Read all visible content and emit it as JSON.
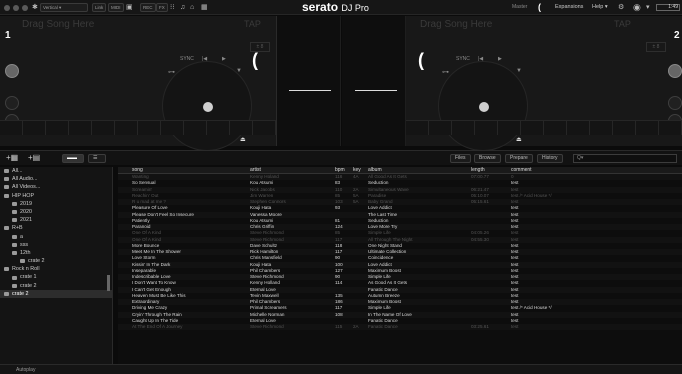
{
  "window": {
    "layout": "Vertical",
    "master": "Master",
    "expansions": "Expansions",
    "help": "Help ▾",
    "clock": "1:49"
  },
  "toolbar": {
    "link": "Link",
    "midi": "MIDI",
    "rec": "REC",
    "fx": "FX"
  },
  "logo": {
    "brand": "serato",
    "product": "DJ Pro"
  },
  "deckA": {
    "number": "1",
    "title": "Drag Song Here",
    "tap": "TAP",
    "sync": "SYNC"
  },
  "deckB": {
    "number": "2",
    "title": "Drag Song Here",
    "tap": "TAP",
    "sync": "SYNC"
  },
  "library_tabs": {
    "files": "Files",
    "browse": "Browse",
    "prepare": "Prepare",
    "history": "History",
    "search_placeholder": "Q▾"
  },
  "sidebar": {
    "items": [
      {
        "label": "All..."
      },
      {
        "label": "All Audio..."
      },
      {
        "label": "All Videos..."
      },
      {
        "label": "HIP HOP"
      },
      {
        "label": "2019"
      },
      {
        "label": "2020"
      },
      {
        "label": "2021"
      },
      {
        "label": "R+B"
      },
      {
        "label": "a"
      },
      {
        "label": "sss"
      },
      {
        "label": "12th"
      },
      {
        "label": "crate 2"
      },
      {
        "label": "Rock n Roll"
      },
      {
        "label": "crate 1"
      },
      {
        "label": "crate 2"
      },
      {
        "label": "crate 2"
      }
    ]
  },
  "columns": {
    "song": "song",
    "artist": "artist",
    "bpm": "bpm",
    "key": "key",
    "album": "album",
    "length": "length",
    "comment": "comment"
  },
  "tracks": [
    {
      "song": "Wanting",
      "artist": "Kenny Holand",
      "bpm": "116",
      "key": "4A",
      "album": "All Good As It Gets",
      "length": "07:00.77",
      "comment": "0",
      "dim": true
    },
    {
      "song": "So Sensual",
      "artist": "Kou Atsumi",
      "bpm": "83",
      "key": "",
      "album": "Seduction",
      "length": "",
      "comment": "test",
      "dim": false
    },
    {
      "song": "Screamin'",
      "artist": "Nick Jacobs",
      "bpm": "110",
      "key": "2A",
      "album": "Simultaneous Wave",
      "length": "06:21.47",
      "comment": "test",
      "dim": true
    },
    {
      "song": "Reachin' Out",
      "artist": "Jim Warren",
      "bpm": "85",
      "key": "5A",
      "album": "Paradise",
      "length": "05:10.07",
      "comment": "test /* Acid House */",
      "dim": true
    },
    {
      "song": "R u mad at me ?",
      "artist": "Stephen Connors",
      "bpm": "103",
      "key": "5A",
      "album": "Baby Grand",
      "length": "05:15.61",
      "comment": "test",
      "dim": true
    },
    {
      "song": "Pleasure Of Love",
      "artist": "Kouji Hata",
      "bpm": "93",
      "key": "",
      "album": "Love Addict",
      "length": "",
      "comment": "test",
      "dim": false
    },
    {
      "song": "Please Don't Feel So Insecure",
      "artist": "Vanessa Moore",
      "bpm": "",
      "key": "",
      "album": "The Last Time",
      "length": "",
      "comment": "test",
      "dim": false
    },
    {
      "song": "Patiently",
      "artist": "Kou Atsumi",
      "bpm": "81",
      "key": "",
      "album": "Seduction",
      "length": "",
      "comment": "test",
      "dim": false
    },
    {
      "song": "Paranoid",
      "artist": "Chris Griffin",
      "bpm": "124",
      "key": "",
      "album": "Love More Try",
      "length": "",
      "comment": "test",
      "dim": false
    },
    {
      "song": "One Of A Kind",
      "artist": "Steve Richmond",
      "bpm": "85",
      "key": "",
      "album": "Simple Life",
      "length": "04:05.26",
      "comment": "test",
      "dim": true
    },
    {
      "song": "One Of A Kind",
      "artist": "Steve Richmond",
      "bpm": "117",
      "key": "",
      "album": "All Through The Night",
      "length": "04:55.30",
      "comment": "test",
      "dim": true
    },
    {
      "song": "More Bounce",
      "artist": "Dave Schultz",
      "bpm": "118",
      "key": "",
      "album": "One Night Stand",
      "length": "",
      "comment": "test",
      "dim": false
    },
    {
      "song": "Meet Me In The Shower",
      "artist": "Rick Hamilton",
      "bpm": "117",
      "key": "",
      "album": "Ultimate Collection",
      "length": "",
      "comment": "test",
      "dim": false
    },
    {
      "song": "Love Storm",
      "artist": "Chris Mansfield",
      "bpm": "90",
      "key": "",
      "album": "Coincidence",
      "length": "",
      "comment": "test",
      "dim": false
    },
    {
      "song": "Kissin' In The Dark",
      "artist": "Kouji Hata",
      "bpm": "100",
      "key": "",
      "album": "Love Addict",
      "length": "",
      "comment": "test",
      "dim": false
    },
    {
      "song": "Inseparable",
      "artist": "Phil Chambers",
      "bpm": "127",
      "key": "",
      "album": "Maximum Boost",
      "length": "",
      "comment": "test",
      "dim": false
    },
    {
      "song": "Indescribable Love",
      "artist": "Steve Richmond",
      "bpm": "90",
      "key": "",
      "album": "Simple Life",
      "length": "",
      "comment": "test",
      "dim": false
    },
    {
      "song": "I Don't Want To Know",
      "artist": "Kenny Holland",
      "bpm": "114",
      "key": "",
      "album": "As Good As It Gets",
      "length": "",
      "comment": "test",
      "dim": false
    },
    {
      "song": "I Can't Get Enough",
      "artist": "Eternal Love",
      "bpm": "",
      "key": "",
      "album": "Fanatic Dance",
      "length": "",
      "comment": "test",
      "dim": false
    },
    {
      "song": "Heaven Must Be Like This",
      "artist": "Tevin Maxwell",
      "bpm": "135",
      "key": "",
      "album": "Autumn Breeze",
      "length": "",
      "comment": "test",
      "dim": false
    },
    {
      "song": "Extraordinary",
      "artist": "Phil Chambers",
      "bpm": "186",
      "key": "",
      "album": "Maximum Boost",
      "length": "",
      "comment": "test",
      "dim": false
    },
    {
      "song": "Driving Me Crazy",
      "artist": "Primal Screamers",
      "bpm": "117",
      "key": "",
      "album": "Simple Life",
      "length": "",
      "comment": "test /* Acid House */",
      "dim": false
    },
    {
      "song": "Cryin' Through The Rain",
      "artist": "Michelle Norman",
      "bpm": "108",
      "key": "",
      "album": "In The Name Of Love",
      "length": "",
      "comment": "test",
      "dim": false
    },
    {
      "song": "Caught Up In The Tide",
      "artist": "Eternal Love",
      "bpm": "",
      "key": "",
      "album": "Fanatic Dance",
      "length": "",
      "comment": "test",
      "dim": false
    },
    {
      "song": "At The End Of A Journey",
      "artist": "Steve Richmond",
      "bpm": "115",
      "key": "2A",
      "album": "Fanatic Dance",
      "length": "03:25.61",
      "comment": "test",
      "dim": true
    }
  ],
  "bottom": {
    "autoplay": "Autoplay"
  }
}
